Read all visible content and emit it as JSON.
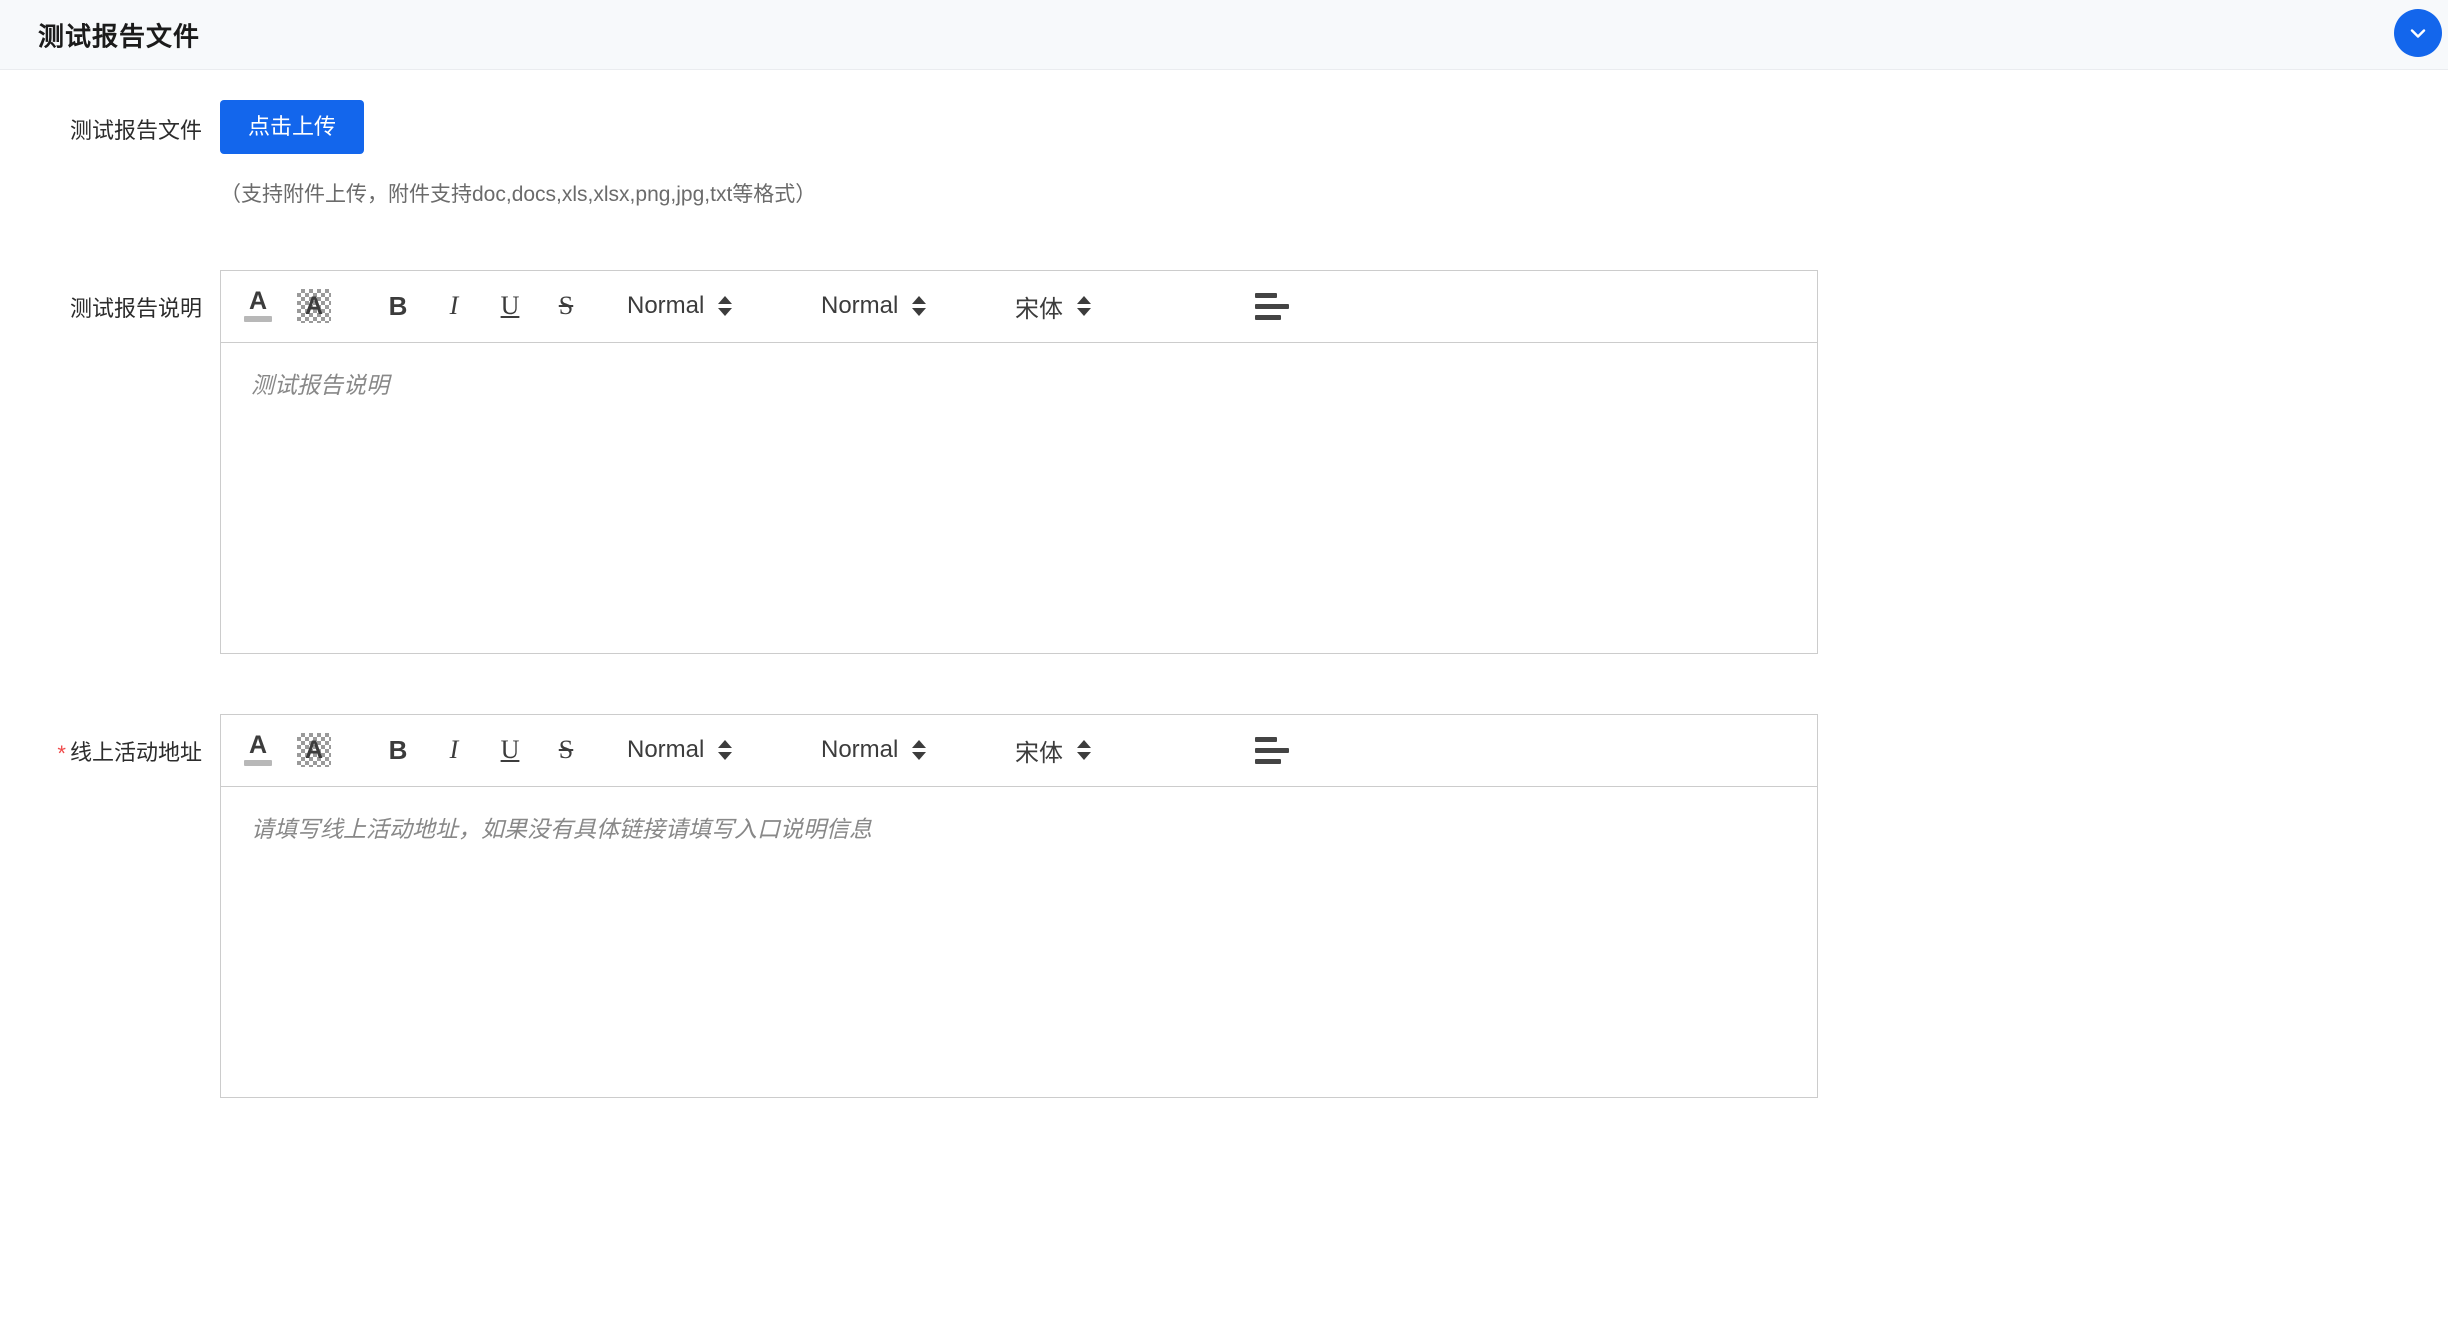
{
  "header": {
    "title": "测试报告文件",
    "collapse_icon": "chevron-down-icon",
    "accent_color": "#1366ec",
    "background_color": "#f7f9fb"
  },
  "upload_row": {
    "label": "测试报告文件",
    "button_label": "点击上传",
    "hint": "（支持附件上传，附件支持doc,docs,xls,xlsx,png,jpg,txt等格式）"
  },
  "editors": [
    {
      "label": "测试报告说明",
      "required": false,
      "required_marker": "",
      "placeholder": "测试报告说明",
      "toolbar": {
        "text_color": {
          "icon": "font-color-icon",
          "glyph": "A"
        },
        "background_color": {
          "icon": "background-color-icon",
          "glyph": "A"
        },
        "bold": "B",
        "italic": "I",
        "underline": "U",
        "strikethrough": "S",
        "header_select": "Normal",
        "size_select": "Normal",
        "font_select": "宋体",
        "align": "align-left-icon"
      }
    },
    {
      "label": "线上活动地址",
      "required": true,
      "required_marker": "*",
      "placeholder": "请填写线上活动地址，如果没有具体链接请填写入口说明信息",
      "toolbar": {
        "text_color": {
          "icon": "font-color-icon",
          "glyph": "A"
        },
        "background_color": {
          "icon": "background-color-icon",
          "glyph": "A"
        },
        "bold": "B",
        "italic": "I",
        "underline": "U",
        "strikethrough": "S",
        "header_select": "Normal",
        "size_select": "Normal",
        "font_select": "宋体",
        "align": "align-left-icon"
      }
    }
  ],
  "colors": {
    "required_star": "#f04a4a",
    "border": "#cccccc",
    "hint_text": "#6b6b6b",
    "placeholder_text": "#888888"
  }
}
